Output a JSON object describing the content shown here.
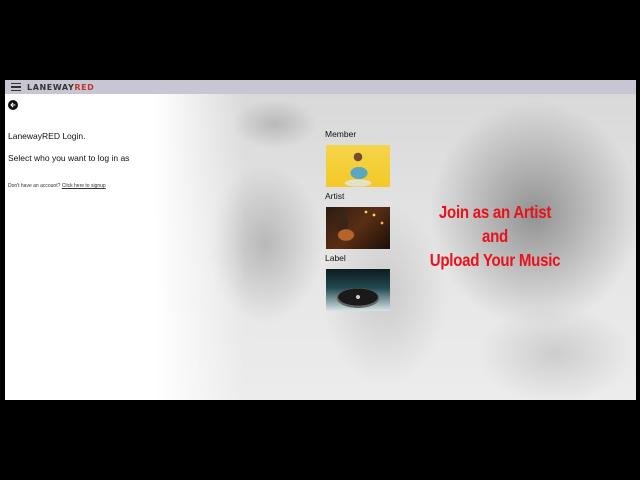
{
  "app": {
    "brand_part1": "LANEWAY",
    "brand_part2": "RED"
  },
  "login": {
    "title": "LanewayRED Login.",
    "subtitle": "Select who you want to log in as",
    "signup_prompt": "Don't have an account?",
    "signup_link": "Click here to signup"
  },
  "roles": [
    {
      "label": "Member"
    },
    {
      "label": "Artist"
    },
    {
      "label": "Label"
    }
  ],
  "promo": {
    "line1": "Join as an Artist",
    "line2": "and",
    "line3": "Upload Your Music"
  },
  "icons": {
    "menu": "hamburger-menu-icon",
    "back": "back-arrow-icon"
  },
  "colors": {
    "brand_red": "#c0392b",
    "promo_red": "#e8121c",
    "title_bar": "#c9c6d3"
  }
}
